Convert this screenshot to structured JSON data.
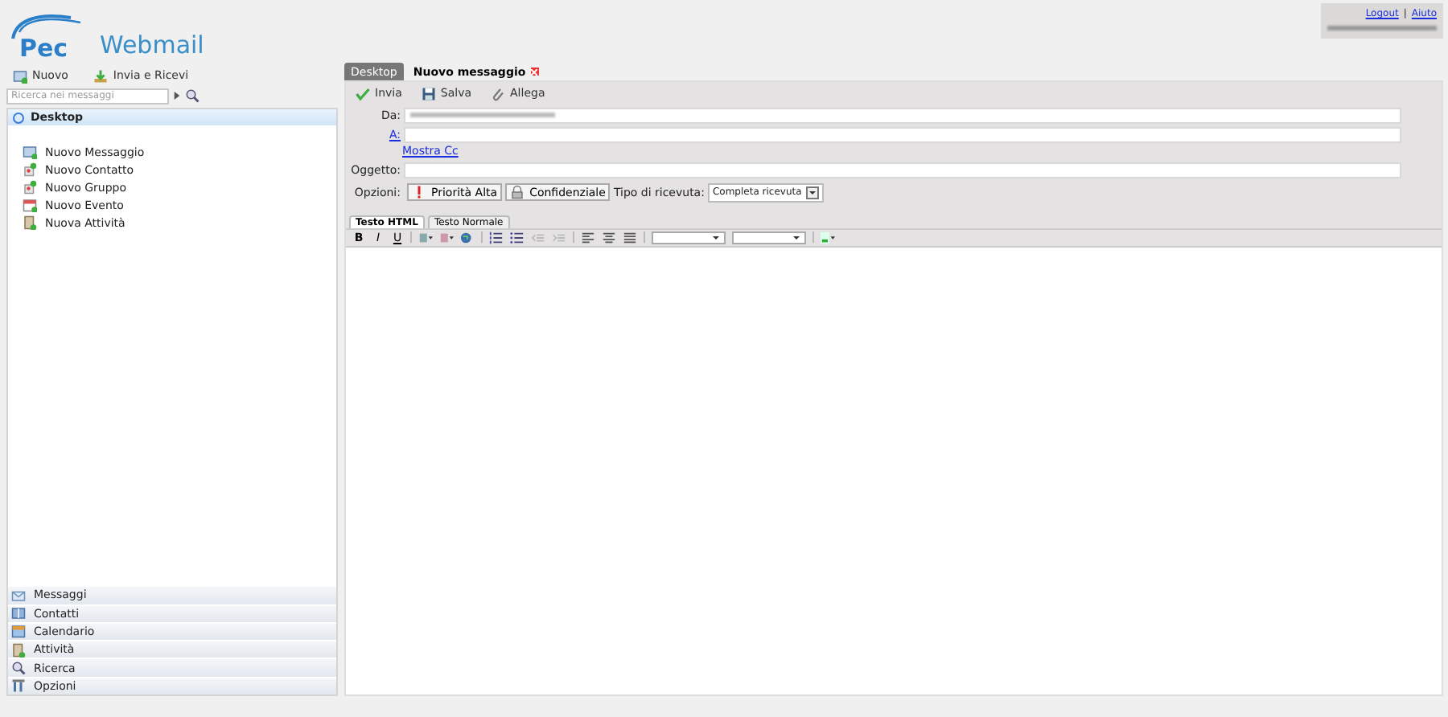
{
  "logo": {
    "brand": "Pec",
    "product": "Webmail"
  },
  "user_links": [
    {
      "label": "Logout"
    },
    {
      "label": "Aiuto"
    }
  ],
  "user_links_separator": "|",
  "toolbar": [
    {
      "label": "Nuovo"
    },
    {
      "label": "Invia e Ricevi"
    }
  ],
  "search": {
    "placeholder": "Ricerca nei messaggi"
  },
  "desktop_panel": {
    "title": "Desktop",
    "items": [
      {
        "label": "Nuovo Messaggio"
      },
      {
        "label": "Nuovo Contatto"
      },
      {
        "label": "Nuovo Gruppo"
      },
      {
        "label": "Nuovo Evento"
      },
      {
        "label": "Nuova Attività"
      }
    ]
  },
  "nav": [
    {
      "label": "Messaggi"
    },
    {
      "label": "Contatti"
    },
    {
      "label": "Calendario"
    },
    {
      "label": "Attività"
    },
    {
      "label": "Ricerca"
    },
    {
      "label": "Opzioni"
    }
  ],
  "tabs": [
    {
      "label": "Desktop",
      "selected": false,
      "closable": false
    },
    {
      "label": "Nuovo messaggio",
      "selected": true,
      "closable": true
    }
  ],
  "compose_toolbar": [
    {
      "label": "Invia"
    },
    {
      "label": "Salva"
    },
    {
      "label": "Allega"
    }
  ],
  "fields": [
    {
      "label": "Da:",
      "kind": "blurred"
    },
    {
      "label": "A:",
      "kind": "link"
    },
    {
      "label": "Oggetto:",
      "kind": "plain"
    }
  ],
  "show_cc": "Mostra Cc",
  "options": {
    "label": "Opzioni:",
    "buttons": [
      {
        "label": "Priorità Alta"
      },
      {
        "label": "Confidenziale"
      }
    ],
    "receipt_label": "Tipo di ricevuta:",
    "receipt_value": "Completa ricevuta"
  },
  "editor_tabs": [
    {
      "label": "Testo HTML",
      "selected": true
    },
    {
      "label": "Testo Normale",
      "selected": false
    }
  ],
  "format_buttons": [
    {
      "label": "B",
      "kind": "bold"
    },
    {
      "label": "I",
      "kind": "italic"
    },
    {
      "label": "U",
      "kind": "underline"
    }
  ]
}
